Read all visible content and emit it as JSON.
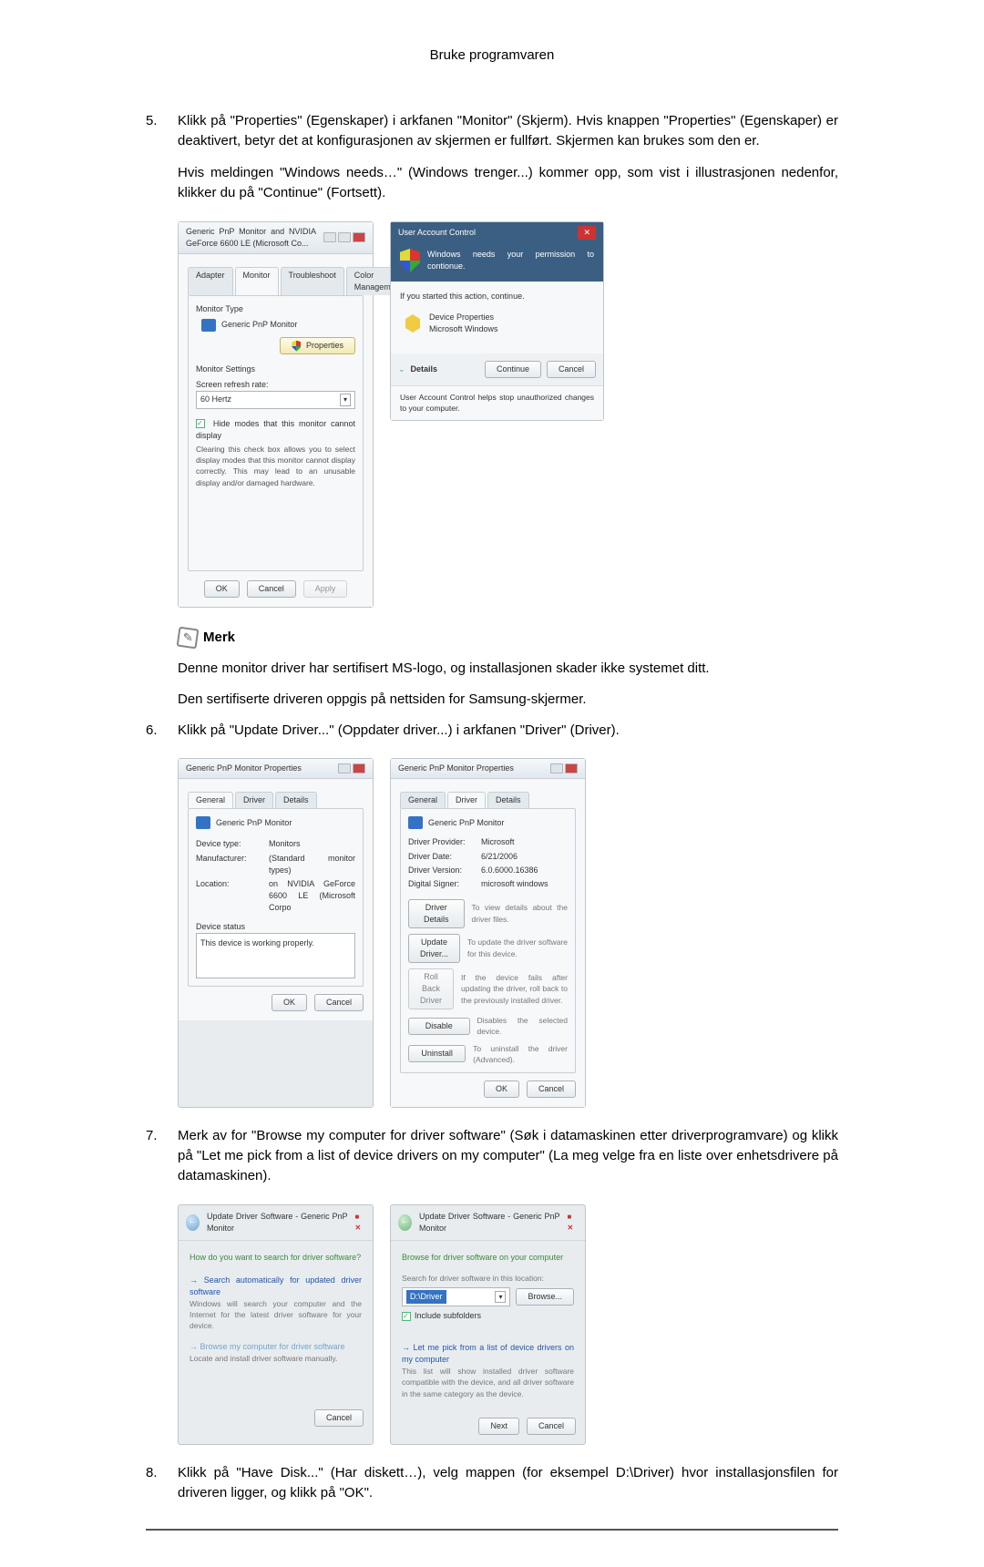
{
  "header": {
    "title": "Bruke programvaren"
  },
  "steps": {
    "s5": {
      "num": "5.",
      "text": "Klikk på \"Properties\" (Egenskaper) i arkfanen \"Monitor\" (Skjerm). Hvis knappen \"Properties\" (Egenskaper) er deaktivert, betyr det at konfigurasjonen av skjermen er fullført. Skjermen kan brukes som den er.",
      "para": "Hvis meldingen \"Windows needs…\" (Windows trenger...) kommer opp, som vist i illustrasjonen nedenfor, klikker du på \"Continue\" (Fortsett)."
    },
    "s6": {
      "num": "6.",
      "text": "Klikk på \"Update Driver...\" (Oppdater driver...) i arkfanen \"Driver\" (Driver)."
    },
    "s7": {
      "num": "7.",
      "text": "Merk av for \"Browse my computer for driver software\" (Søk i datamaskinen etter driverprogramvare) og klikk på \"Let me pick from a list of device drivers on my computer\" (La meg velge fra en liste over enhetsdrivere på datamaskinen)."
    },
    "s8": {
      "num": "8.",
      "text": "Klikk på \"Have Disk...\" (Har diskett…), velg mappen (for eksempel D:\\Driver) hvor installasjonsfilen for driveren ligger, og klikk på \"OK\"."
    }
  },
  "note": {
    "title": "Merk",
    "line1": "Denne monitor driver har sertifisert MS-logo, og installasjonen skader ikke systemet ditt.",
    "line2": "Den sertifiserte driveren oppgis på nettsiden for Samsung-skjermer."
  },
  "fig_monitor_tab": {
    "title": "Generic PnP Monitor and NVIDIA GeForce 6600 LE (Microsoft Co...",
    "tabs": [
      "Adapter",
      "Monitor",
      "Troubleshoot",
      "Color Management"
    ],
    "monitor_type_label": "Monitor Type",
    "monitor_name": "Generic PnP Monitor",
    "properties_btn": "Properties",
    "settings_label": "Monitor Settings",
    "refresh_label": "Screen refresh rate:",
    "refresh_value": "60 Hertz",
    "hide_modes": "Hide modes that this monitor cannot display",
    "hide_desc": "Clearing this check box allows you to select display modes that this monitor cannot display correctly. This may lead to an unusable display and/or damaged hardware.",
    "ok": "OK",
    "cancel": "Cancel",
    "apply": "Apply"
  },
  "fig_uac": {
    "title": "User Account Control",
    "perm": "Windows needs your permission to contionue.",
    "started": "If you started this action, continue.",
    "prop": "Device Properties",
    "ms": "Microsoft Windows",
    "details": "Details",
    "continue": "Continue",
    "cancel": "Cancel",
    "footer": "User Account Control helps stop unauthorized changes to your computer."
  },
  "fig_general": {
    "title": "Generic PnP Monitor Properties",
    "tabs": [
      "General",
      "Driver",
      "Details"
    ],
    "name": "Generic PnP Monitor",
    "device_type_k": "Device type:",
    "device_type_v": "Monitors",
    "manufacturer_k": "Manufacturer:",
    "manufacturer_v": "(Standard monitor types)",
    "location_k": "Location:",
    "location_v": "on NVIDIA GeForce 6600 LE (Microsoft Corpo",
    "status_label": "Device status",
    "status_text": "This device is working properly.",
    "ok": "OK",
    "cancel": "Cancel"
  },
  "fig_driver": {
    "title": "Generic PnP Monitor Properties",
    "tabs": [
      "General",
      "Driver",
      "Details"
    ],
    "name": "Generic PnP Monitor",
    "provider_k": "Driver Provider:",
    "provider_v": "Microsoft",
    "date_k": "Driver Date:",
    "date_v": "6/21/2006",
    "version_k": "Driver Version:",
    "version_v": "6.0.6000.16386",
    "signer_k": "Digital Signer:",
    "signer_v": "microsoft windows",
    "btn_details": "Driver Details",
    "desc_details": "To view details about the driver files.",
    "btn_update": "Update Driver...",
    "desc_update": "To update the driver software for this device.",
    "btn_rollback": "Roll Back Driver",
    "desc_rollback": "If the device fails after updating the driver, roll back to the previously installed driver.",
    "btn_disable": "Disable",
    "desc_disable": "Disables the selected device.",
    "btn_uninstall": "Uninstall",
    "desc_uninstall": "To uninstall the driver (Advanced).",
    "ok": "OK",
    "cancel": "Cancel"
  },
  "fig_wiz1": {
    "crumb": "Update Driver Software - Generic PnP Monitor",
    "question": "How do you want to search for driver software?",
    "opt1_t": "Search automatically for updated driver software",
    "opt1_d": "Windows will search your computer and the Internet for the latest driver software for your device.",
    "opt2_t": "Browse my computer for driver software",
    "opt2_d": "Locate and install driver software manually.",
    "cancel": "Cancel"
  },
  "fig_wiz2": {
    "crumb": "Update Driver Software - Generic PnP Monitor",
    "heading": "Browse for driver software on your computer",
    "search_label": "Search for driver software in this location:",
    "path": "D:\\Driver",
    "browse": "Browse...",
    "include": "Include subfolders",
    "pick_t": "Let me pick from a list of device drivers on my computer",
    "pick_d": "This list will show installed driver software compatible with the device, and all driver software in the same category as the device.",
    "next": "Next",
    "cancel": "Cancel"
  }
}
